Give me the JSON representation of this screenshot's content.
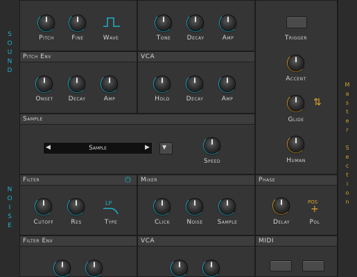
{
  "strips": {
    "left_top": [
      "S",
      "O",
      "U",
      "N",
      "D"
    ],
    "left_bottom": [
      "N",
      "O",
      "I",
      "S",
      "E"
    ],
    "right": [
      "M",
      "a",
      "s",
      "t",
      "e",
      "r",
      "",
      "S",
      "e",
      "c",
      "t",
      "i",
      "o",
      "n"
    ]
  },
  "row1": {
    "left_labels": [
      "Pitch",
      "Fine",
      "Wave"
    ],
    "mid_labels": [
      "Tone",
      "Decay",
      "Amp"
    ]
  },
  "pitch_env": {
    "title": "Pitch Env",
    "labels": [
      "Onset",
      "Decay",
      "Amp"
    ]
  },
  "vca_top": {
    "title": "VCA",
    "labels": [
      "Hold",
      "Decay",
      "Amp"
    ]
  },
  "sample": {
    "title": "Sample",
    "select_value": "Sample",
    "prev_glyph": "◀",
    "next_glyph": "▶",
    "dropdown_glyph": "▼",
    "speed_label": "Speed"
  },
  "filter": {
    "title": "Filter",
    "labels": [
      "Cutoff",
      "Res",
      "Type"
    ],
    "type_value": "LP",
    "power_glyph": "⏻"
  },
  "mixer": {
    "title": "Mixer",
    "labels": [
      "Click",
      "Noise",
      "Sample"
    ]
  },
  "phase": {
    "title": "Phase",
    "labels": [
      "Delay",
      "Pol"
    ],
    "pol_value": "POS",
    "pol_glyph": "+"
  },
  "filter_env": {
    "title": "Filter Env"
  },
  "vca_bottom": {
    "title": "VCA"
  },
  "midi": {
    "title": "MIDI"
  },
  "master": {
    "labels": [
      "Trigger",
      "Accent",
      "Glide",
      "Human"
    ],
    "glide_glyph": "⇅"
  },
  "colors": {
    "noise_accent": "#1fb2c9",
    "master_accent": "#d8a32a",
    "background": "#2a2a2a"
  }
}
